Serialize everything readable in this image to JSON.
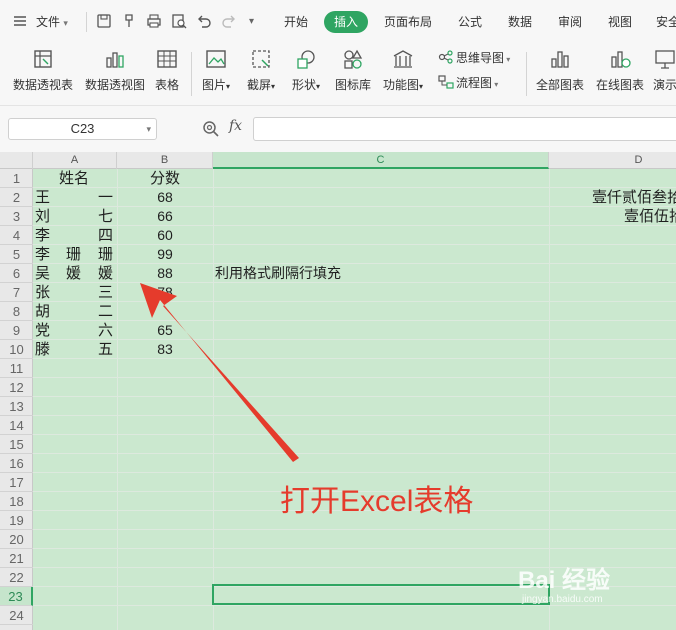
{
  "menu": {
    "file_label": "文件",
    "tabs": [
      "开始",
      "插入",
      "页面布局",
      "公式",
      "数据",
      "审阅",
      "视图",
      "安全"
    ],
    "active_tab": "插入"
  },
  "ribbon": {
    "pivot_table": "数据透视表",
    "pivot_chart": "数据透视图",
    "table": "表格",
    "picture": "图片",
    "screenshot": "截屏",
    "shapes": "形状",
    "icon_library": "图标库",
    "function_chart": "功能图",
    "mind_map": "思维导图",
    "flowchart": "流程图",
    "all_charts": "全部图表",
    "online_charts": "在线图表",
    "present": "演示"
  },
  "formula_bar": {
    "name_box": "C23",
    "fx_label": "fx",
    "formula": ""
  },
  "grid": {
    "columns": [
      "A",
      "B",
      "C",
      "D"
    ],
    "selected_column": "C",
    "rows": [
      "1",
      "2",
      "3",
      "4",
      "5",
      "6",
      "7",
      "8",
      "9",
      "10",
      "11",
      "12",
      "13",
      "14",
      "15",
      "16",
      "17",
      "18",
      "19",
      "20",
      "21",
      "22",
      "23",
      "24"
    ],
    "selected_row": "23",
    "header_name": "姓名",
    "header_score": "分数",
    "names": [
      {
        "a": "王",
        "b": "",
        "c": "一"
      },
      {
        "a": "刘",
        "b": "",
        "c": "七"
      },
      {
        "a": "李",
        "b": "",
        "c": "四"
      },
      {
        "a": "李",
        "b": "珊",
        "c": "珊"
      },
      {
        "a": "吴",
        "b": "媛",
        "c": "媛"
      },
      {
        "a": "张",
        "b": "",
        "c": "三"
      },
      {
        "a": "胡",
        "b": "",
        "c": "二"
      },
      {
        "a": "党",
        "b": "",
        "c": "六"
      },
      {
        "a": "滕",
        "b": "",
        "c": "五"
      }
    ],
    "scores": [
      "68",
      "66",
      "60",
      "99",
      "88",
      "78",
      "",
      "65",
      "83"
    ],
    "c6_text": "利用格式刷隔行填充",
    "d2_text": "壹仟贰佰叁拾",
    "d3_text": "壹佰伍拾"
  },
  "annotation": {
    "caption": "打开Excel表格",
    "color": "#e53b2c"
  },
  "watermark": {
    "main": "Bai 经验",
    "sub": "jingyan.baidu.com"
  },
  "colors": {
    "accent": "#2fa562",
    "cell_fill": "#cbe8cf"
  }
}
